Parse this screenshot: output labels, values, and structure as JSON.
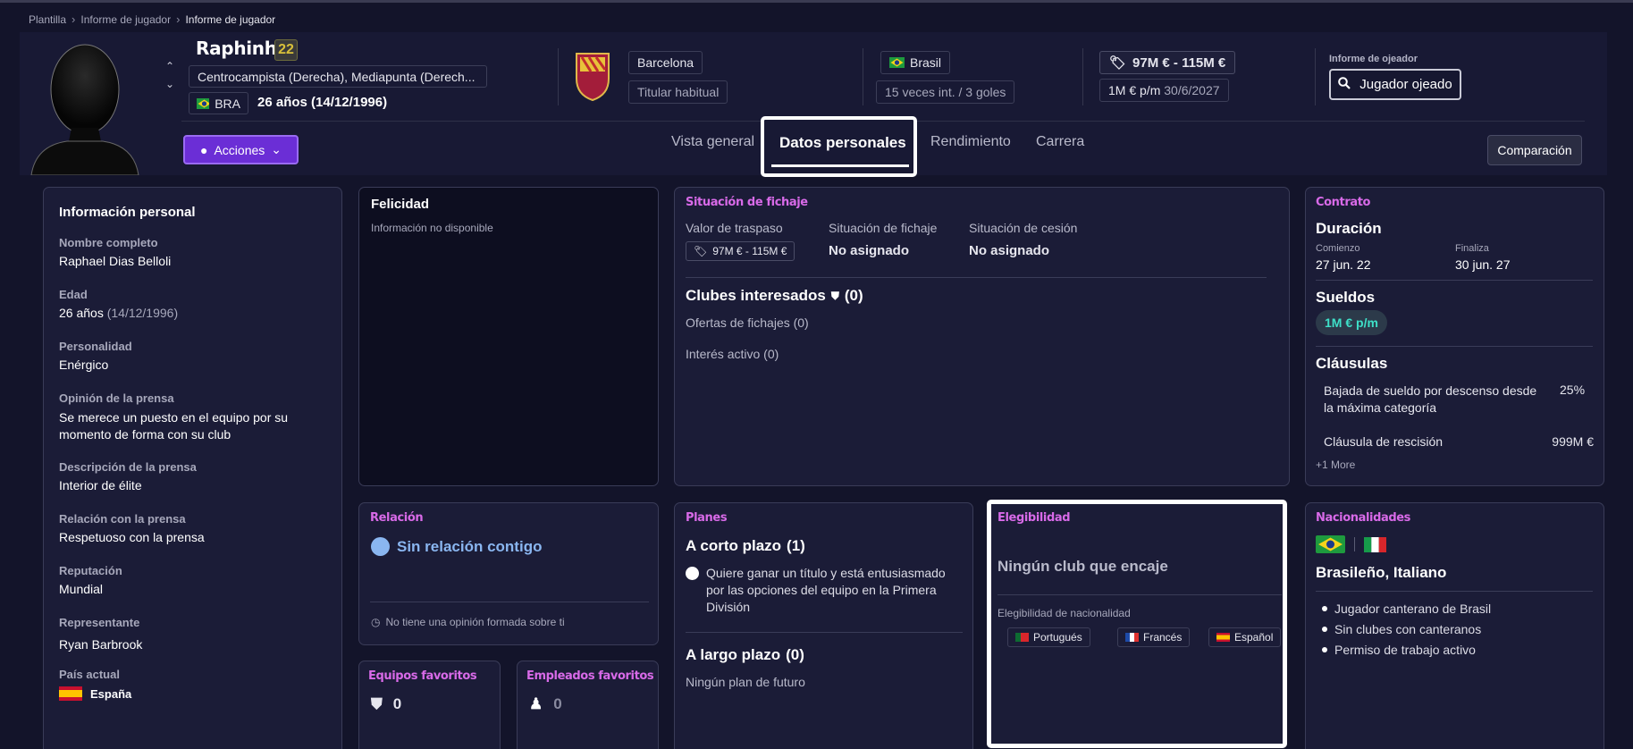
{
  "breadcrumb": {
    "items": [
      "Plantilla",
      "Informe de jugador",
      "Informe de jugador"
    ]
  },
  "player": {
    "name": "Raphinha",
    "number": "22",
    "positions": "Centrocampista (Derecha), Mediapunta (Derech...",
    "nationality_code": "BRA",
    "age": "26 años (14/12/1996)"
  },
  "club": {
    "name": "Barcelona",
    "role": "Titular habitual"
  },
  "country": {
    "name": "Brasil",
    "caps": "15 veces int. / 3 goles"
  },
  "value": {
    "range": "97M € - 115M €",
    "wage": "1M € p/m",
    "contract_end": "30/6/2027"
  },
  "scout": {
    "label": "Informe de ojeador",
    "button": "Jugador ojeado"
  },
  "actions": {
    "button": "Acciones"
  },
  "tabs": {
    "overview": "Vista general",
    "personal": "Datos personales",
    "performance": "Rendimiento",
    "career": "Carrera"
  },
  "compare": "Comparación",
  "personal_info": {
    "title": "Información personal",
    "fields": [
      {
        "label": "Nombre completo",
        "value": "Raphael Dias Belloli"
      },
      {
        "label": "Edad",
        "value": "26 años",
        "extra": "(14/12/1996)"
      },
      {
        "label": "Personalidad",
        "value": "Enérgico"
      },
      {
        "label": "Opinión de la prensa",
        "value": "Se merece un puesto en el equipo por su momento de forma con su club"
      },
      {
        "label": "Descripción de la prensa",
        "value": "Interior de élite"
      },
      {
        "label": "Relación con la prensa",
        "value": "Respetuoso con la prensa"
      },
      {
        "label": "Reputación",
        "value": "Mundial"
      },
      {
        "label": "Representante",
        "value": "Ryan Barbrook"
      },
      {
        "label": "País actual",
        "value": "España"
      }
    ]
  },
  "happiness": {
    "title": "Felicidad",
    "text": "Información no disponible"
  },
  "transfer": {
    "title": "Situación de fichaje",
    "value_label": "Valor de traspaso",
    "value": "97M € - 115M €",
    "status_label": "Situación de fichaje",
    "status": "No asignado",
    "loan_label": "Situación de cesión",
    "loan": "No asignado",
    "interested": "Clubes interesados",
    "interested_count": "(0)",
    "offers": "Ofertas de fichajes  (0)",
    "active": "Interés activo (0)"
  },
  "contract": {
    "title": "Contrato",
    "duration": "Duración",
    "start_label": "Comienzo",
    "start": "27 jun. 22",
    "end_label": "Finaliza",
    "end": "30 jun. 27",
    "wages": "Sueldos",
    "wage": "1M € p/m",
    "clauses": "Cláusulas",
    "clause1": "Bajada de sueldo por descenso desde la máxima categoría",
    "clause1_val": "25%",
    "clause2": "Cláusula de rescisión",
    "clause2_val": "999M €",
    "more": "+1 More"
  },
  "relation": {
    "title": "Relación",
    "status": "Sin relación contigo",
    "note": "No tiene una opinión formada sobre ti"
  },
  "plans": {
    "title": "Planes",
    "short": "A corto plazo",
    "short_count": "(1)",
    "short_text": "Quiere ganar un título y está entusiasmado por las opciones del equipo en la Primera División",
    "long": "A largo plazo",
    "long_count": "(0)",
    "long_text": "Ningún plan de futuro"
  },
  "eligibility": {
    "title": "Elegibilidad",
    "text": "Ningún club que encaje",
    "nat_label": "Elegibilidad de nacionalidad",
    "langs": [
      "Portugués",
      "Francés",
      "Español"
    ]
  },
  "nationalities": {
    "title": "Nacionalidades",
    "names": "Brasileño, Italiano",
    "items": [
      "Jugador canterano de Brasil",
      "Sin clubes con canteranos",
      "Permiso de trabajo activo"
    ]
  },
  "fav_teams": {
    "title": "Equipos favoritos",
    "count": "0"
  },
  "fav_staff": {
    "title": "Empleados favoritos",
    "count": "0"
  },
  "colors": {
    "accent": "#d86ae8",
    "bg": "#13142a",
    "purple": "#6b2ed6",
    "teal": "#3ee0c8"
  }
}
